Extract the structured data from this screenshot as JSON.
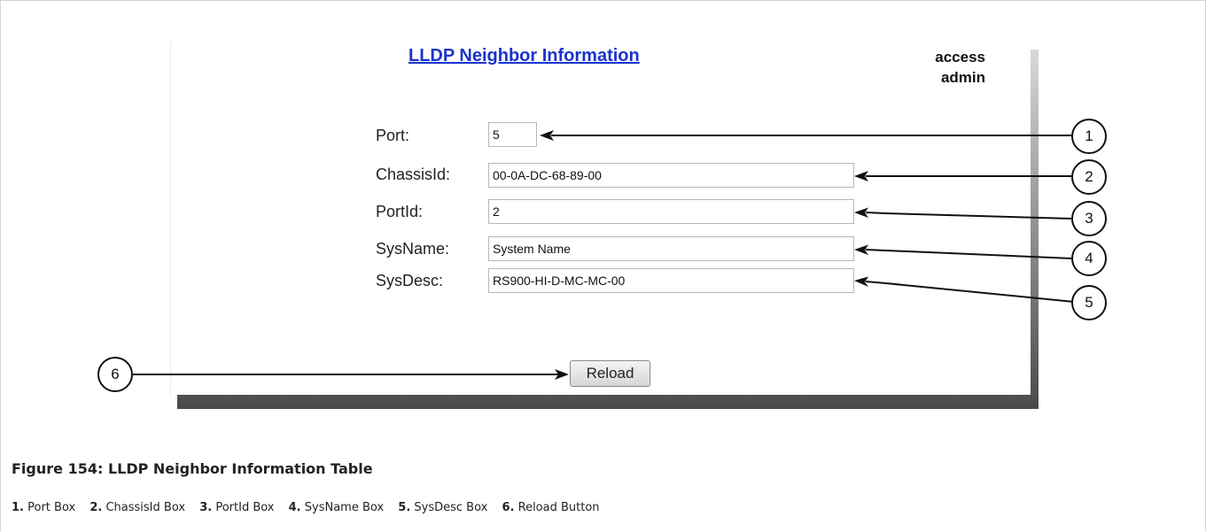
{
  "panel": {
    "title": "LLDP Neighbor Information",
    "access_label": "access",
    "access_value": "admin"
  },
  "fields": {
    "port": {
      "label": "Port:",
      "value": "5"
    },
    "chassis_id": {
      "label": "ChassisId:",
      "value": "00-0A-DC-68-89-00"
    },
    "port_id": {
      "label": "PortId:",
      "value": "2"
    },
    "sys_name": {
      "label": "SysName:",
      "value": "System Name"
    },
    "sys_desc": {
      "label": "SysDesc:",
      "value": "RS900-HI-D-MC-MC-00"
    }
  },
  "reload_label": "Reload",
  "callouts": [
    "1",
    "2",
    "3",
    "4",
    "5",
    "6"
  ],
  "caption": "Figure 154: LLDP Neighbor Information Table",
  "legend": [
    {
      "num": "1.",
      "text": "Port Box"
    },
    {
      "num": "2.",
      "text": "ChassisId Box"
    },
    {
      "num": "3.",
      "text": "PortId Box"
    },
    {
      "num": "4.",
      "text": "SysName Box"
    },
    {
      "num": "5.",
      "text": "SysDesc Box"
    },
    {
      "num": "6.",
      "text": "Reload Button"
    }
  ]
}
